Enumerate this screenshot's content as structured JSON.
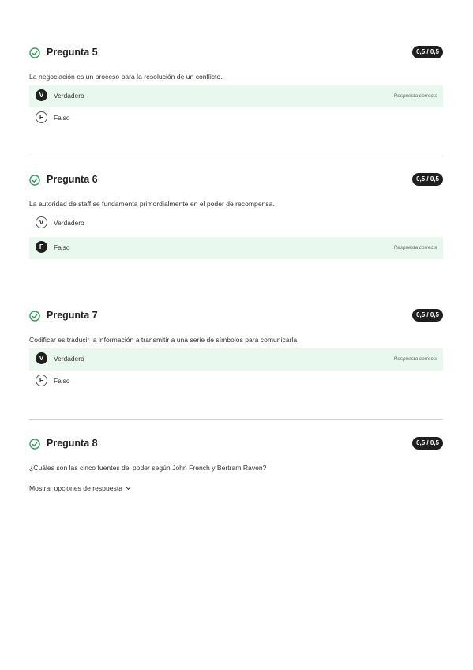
{
  "questions": [
    {
      "title": "Pregunta 5",
      "score": "0,5 / 0,5",
      "statement": "La negociación es un proceso para la resolución de un conflicto.",
      "options": [
        {
          "letter": "V",
          "label": "Verdadero",
          "selected": true,
          "result": "Respuesta correcta"
        },
        {
          "letter": "F",
          "label": "Falso",
          "selected": false,
          "result": ""
        }
      ]
    },
    {
      "title": "Pregunta 6",
      "score": "0,5 / 0,5",
      "statement": "La autoridad de staff se fundamenta primordialmente en el poder de recompensa.",
      "options": [
        {
          "letter": "V",
          "label": "Verdadero",
          "selected": false,
          "result": ""
        },
        {
          "letter": "F",
          "label": "Falso",
          "selected": true,
          "result": "Respuesta correcta"
        }
      ]
    },
    {
      "title": "Pregunta 7",
      "score": "0,5 / 0,5",
      "statement": "Codificar es traducir la información a transmitir a una serie de símbolos para comunicarla.",
      "options": [
        {
          "letter": "V",
          "label": "Verdadero",
          "selected": true,
          "result": "Respuesta correcta"
        },
        {
          "letter": "F",
          "label": "Falso",
          "selected": false,
          "result": ""
        }
      ]
    },
    {
      "title": "Pregunta 8",
      "score": "0,5 / 0,5",
      "statement": "¿Cuáles son las cinco fuentes del poder según John French y Bertram Raven?",
      "show_options": "Mostrar opciones de respuesta"
    }
  ],
  "colors": {
    "correct_bg": "#e8f8ee",
    "check_green": "#2e9e5b",
    "dark": "#1f1f1f"
  },
  "icons": {
    "status": "check-circle-icon",
    "expand": "chevron-down-icon"
  }
}
